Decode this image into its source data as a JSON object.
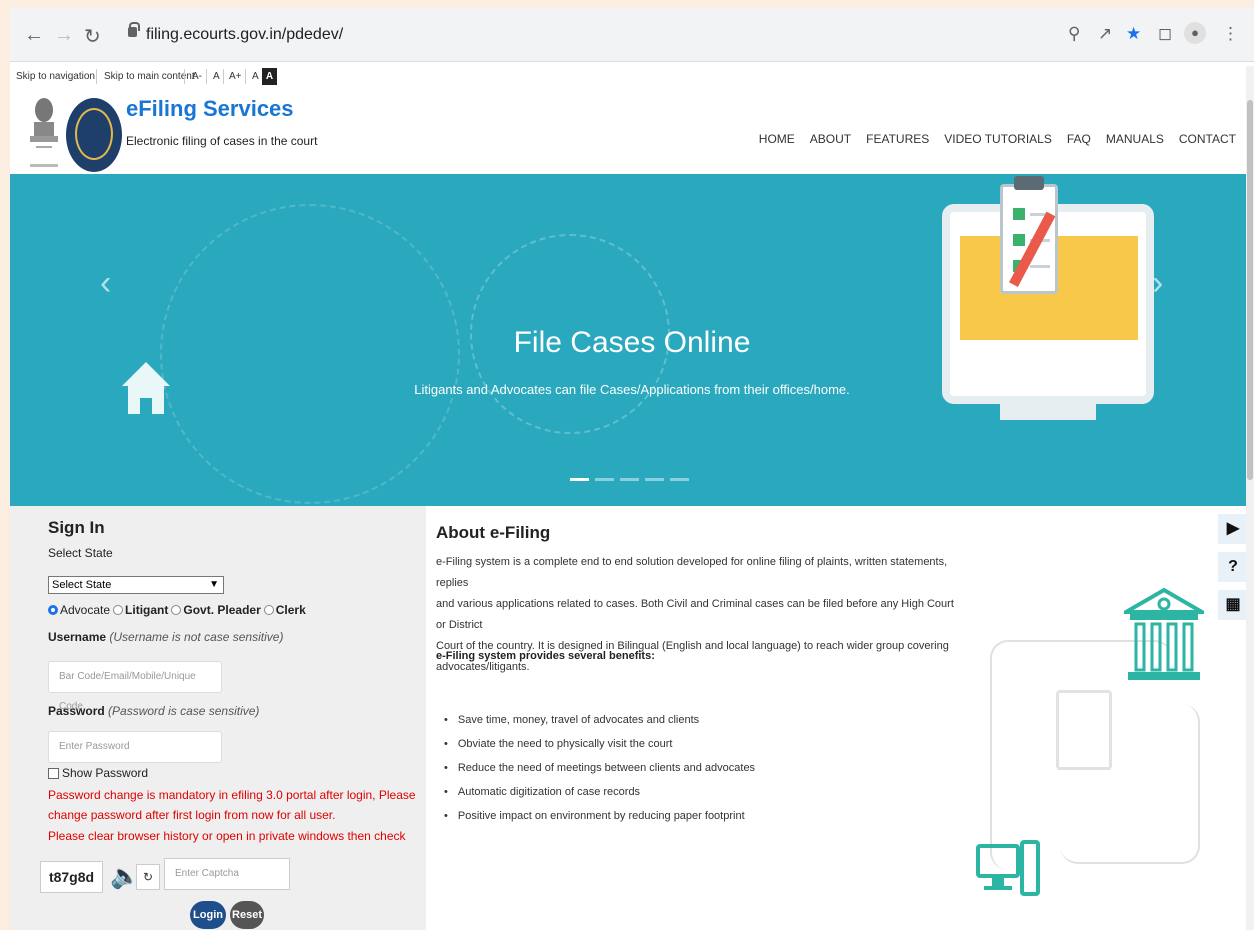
{
  "browser": {
    "url": "filing.ecourts.gov.in/pdedev/"
  },
  "accessibility": {
    "skip_nav": "Skip to navigation",
    "skip_main": "Skip to main content",
    "font_minus": "A-",
    "font_normal": "A",
    "font_plus": "A+",
    "contrast_light": "A",
    "contrast_dark": "A"
  },
  "header": {
    "title": "eFiling Services",
    "tagline": "Electronic filing of cases in the court",
    "menu": [
      "HOME",
      "ABOUT",
      "FEATURES",
      "VIDEO TUTORIALS",
      "FAQ",
      "MANUALS",
      "CONTACT"
    ]
  },
  "hero": {
    "title": "File Cases Online",
    "subtitle": "Litigants and Advocates can file Cases/Applications from their offices/home.",
    "slides": [
      "1",
      "2",
      "3",
      "4",
      "5"
    ],
    "active_slide": 1
  },
  "signin": {
    "title": "Sign In",
    "state_label": "Select State",
    "state_value": "Select State",
    "roles": [
      "Advocate",
      "Litigant",
      "Govt. Pleader",
      "Clerk"
    ],
    "selected_role": "Advocate",
    "username_label": "Username",
    "username_hint": "(Username is not case sensitive)",
    "username_placeholder": "Bar Code/Email/Mobile/Unique Code",
    "password_label": "Password",
    "password_hint": "(Password is case sensitive)",
    "password_placeholder": "Enter Password",
    "show_password": "Show Password",
    "warning_1": "Password change is mandatory in efiling 3.0 portal after login, Please",
    "warning_2": "change password after first login from now for all user.",
    "warning_3": "Please clear browser history or open in private windows then check",
    "captcha_code": "t87g8d",
    "captcha_placeholder": "Enter Captcha",
    "login": "Login",
    "reset": "Reset"
  },
  "about": {
    "title": "About e-Filing",
    "text_1": "e-Filing system is a complete end to end solution developed for online filing of plaints, written statements, replies",
    "text_2": "and various applications related to cases. Both Civil and Criminal cases can be filed before any High Court or District",
    "text_3": "Court of the country. It is designed in Bilingual (English and local language) to reach wider group covering",
    "text_4": "advocates/litigants.",
    "benefits_heading": "e-Filing system provides several benefits:",
    "benefits": [
      "Save time, money, travel of advocates and clients",
      "Obviate the need to physically visit the court",
      "Reduce the need of meetings between clients and advocates",
      "Automatic digitization of case records",
      "Positive impact on environment by reducing paper footprint"
    ]
  },
  "colors": {
    "brand": "#1976d2",
    "hero": "#2aa8be",
    "warning": "#e10000",
    "login": "#1f4f8a",
    "reset": "#555555",
    "illustration": "#2bb5a2"
  }
}
